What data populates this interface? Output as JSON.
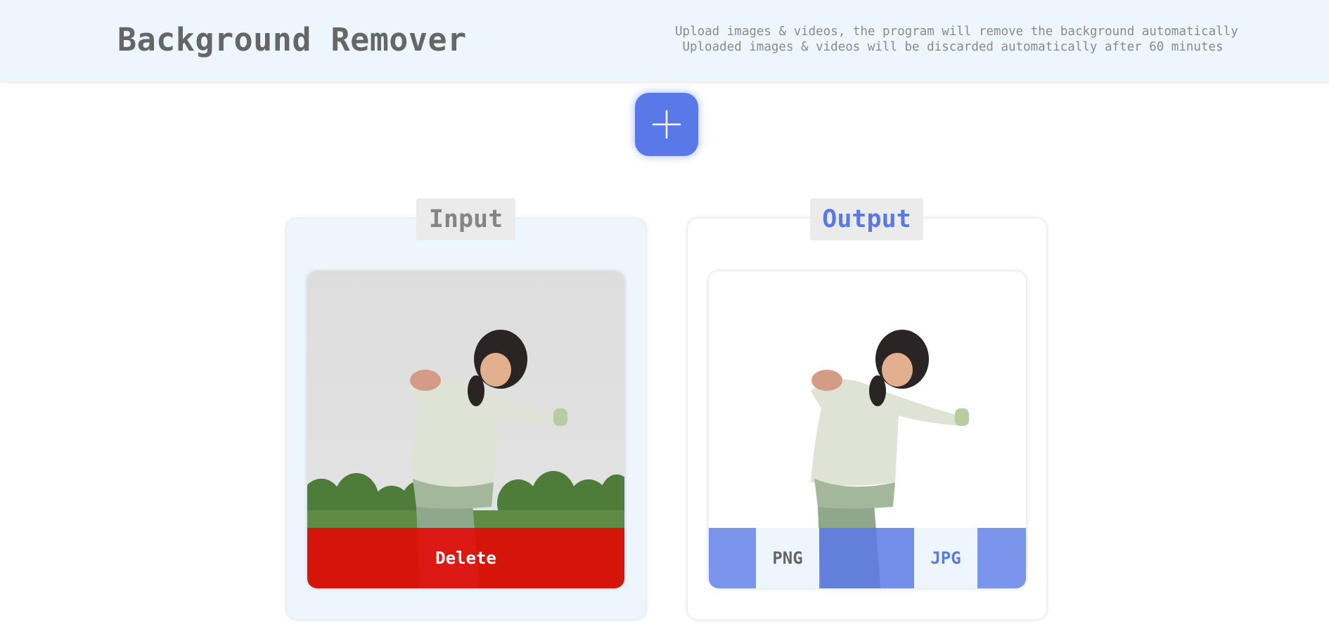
{
  "header": {
    "title": "Background Remover",
    "subtitle_line1": "Upload images & videos, the program will remove the background automatically",
    "subtitle_line2": "Uploaded images & videos will be discarded automatically after 60 minutes"
  },
  "upload": {
    "icon": "plus-icon",
    "color": "#5a79e8"
  },
  "input_panel": {
    "label": "Input",
    "delete_label": "Delete",
    "delete_color": "#eb0000"
  },
  "output_panel": {
    "label": "Output",
    "formats": [
      {
        "label": "PNG",
        "color": "#666666"
      },
      {
        "label": "JPG",
        "color": "#5a79e8"
      }
    ]
  }
}
